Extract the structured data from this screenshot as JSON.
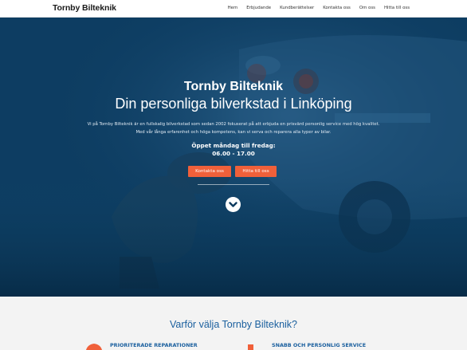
{
  "navbar": {
    "brand": "Tornby Bilteknik",
    "links": [
      "Hem",
      "Erbjudande",
      "Kundberättelser",
      "Kontakta oss",
      "Om oss",
      "Hitta till oss"
    ]
  },
  "hero": {
    "title": "Tornby Bilteknik",
    "subtitle": "Din personliga bilverkstad i Linköping",
    "description": "Vi på Tornby Bilteknik är en fullskalig bilverkstad som sedan 2002 fokuserat på att erbjuda en prisvärd personlig service med hög kvalitet. Med vår långa erfarenhet och höga kompetens, kan vi serva och reparera alla typer av bilar.",
    "hours_label": "Öppet måndag till fredag:",
    "hours_time": "06.00 - 17.00",
    "contact_button": "Kontakta oss",
    "find_button": "Hitta till oss",
    "scroll_icon": "chevron-down-icon"
  },
  "why": {
    "title": "Varför välja Tornby Bilteknik?",
    "features": [
      {
        "title": "PRIORITERADE REPARATIONER",
        "icon": "clock-icon"
      },
      {
        "title": "SNABB OCH PERSONLIG SERVICE",
        "icon": "wrench-icon"
      }
    ]
  },
  "colors": {
    "accent": "#f0603a",
    "hero_overlay": "#0c3a5e",
    "heading_blue": "#1a5f9e"
  }
}
